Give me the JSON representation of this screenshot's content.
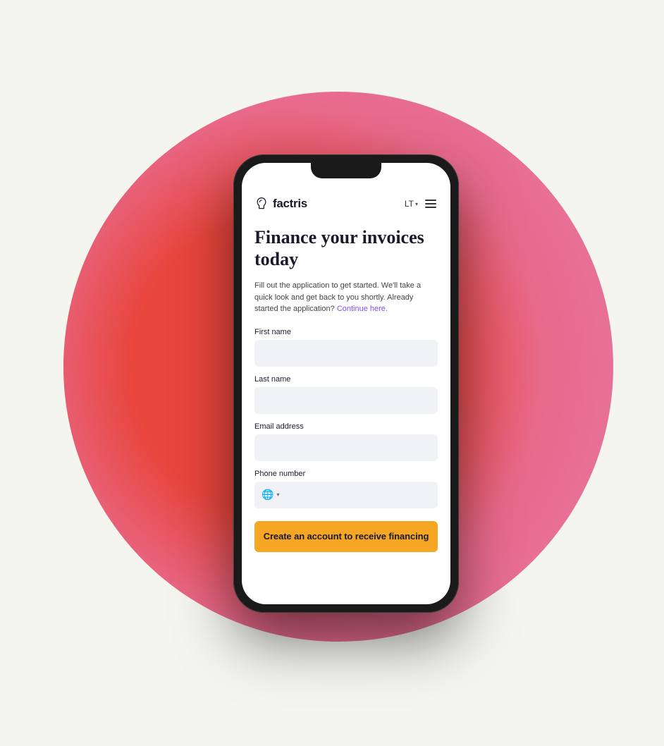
{
  "background": {
    "blob_color_start": "#e8453c",
    "blob_color_end": "#e87aaa"
  },
  "phone": {
    "screen": {
      "navbar": {
        "logo_text": "factris",
        "lang": "LT",
        "lang_aria": "language selector"
      },
      "hero": {
        "title": "Finance your invoices today"
      },
      "description": {
        "text_before": "Fill out the application to get started. We'll take a quick look and get back to you shortly. Already started the application?",
        "link_text": "Continue here."
      },
      "form": {
        "first_name_label": "First name",
        "first_name_placeholder": "",
        "last_name_label": "Last name",
        "last_name_placeholder": "",
        "email_label": "Email address",
        "email_placeholder": "",
        "phone_label": "Phone number",
        "phone_placeholder": "",
        "submit_label": "Create an account to receive financing"
      }
    }
  }
}
